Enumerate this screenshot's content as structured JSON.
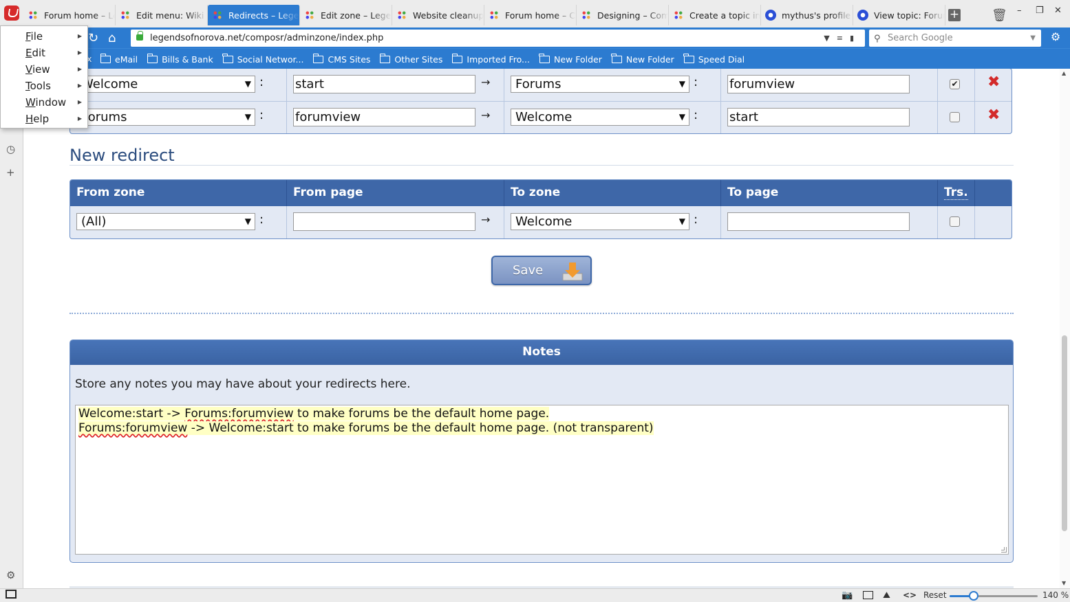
{
  "browser": {
    "tabs": [
      {
        "title": "Forum home – Leg",
        "icon": "composr-icon",
        "active": false
      },
      {
        "title": "Edit menu: Wiki – I",
        "icon": "composr-icon",
        "active": false
      },
      {
        "title": "Redirects – Legen",
        "icon": "composr-icon",
        "active": true
      },
      {
        "title": "Edit zone – Legenc",
        "icon": "composr-icon",
        "active": false
      },
      {
        "title": "Website cleanup t",
        "icon": "composr-icon",
        "active": false
      },
      {
        "title": "Forum home – Cor",
        "icon": "composr-icon",
        "active": false
      },
      {
        "title": "Designing – Comp",
        "icon": "composr-icon",
        "active": false
      },
      {
        "title": "Create a topic in D",
        "icon": "composr-icon",
        "active": false
      },
      {
        "title": "mythus's profile –",
        "icon": "globe-icon",
        "active": false
      },
      {
        "title": "View topic: Forum",
        "icon": "globe-icon",
        "active": false
      }
    ],
    "url": "legendsofnorova.net/composr/adminzone/index.php",
    "search_placeholder": "Search Google",
    "bookmarks": [
      {
        "label": "eMail"
      },
      {
        "label": "Bills & Bank"
      },
      {
        "label": "Social Networ..."
      },
      {
        "label": "CMS Sites"
      },
      {
        "label": "Other Sites"
      },
      {
        "label": "Imported Fro..."
      },
      {
        "label": "New Folder"
      },
      {
        "label": "New Folder"
      },
      {
        "label": "Speed Dial"
      }
    ],
    "bookmark_partial": "x",
    "accent_color": "#2c7bd0"
  },
  "menu": {
    "items": [
      {
        "label": "File",
        "accel": "F"
      },
      {
        "label": "Edit",
        "accel": "E"
      },
      {
        "label": "View",
        "accel": "V"
      },
      {
        "label": "Tools",
        "accel": "T"
      },
      {
        "label": "Window",
        "accel": "W"
      },
      {
        "label": "Help",
        "accel": "H"
      }
    ]
  },
  "existing": {
    "rows": [
      {
        "from_zone": "Welcome",
        "from_page": "start",
        "to_zone": "Forums",
        "to_page": "forumview",
        "transparent": true
      },
      {
        "from_zone": "Forums",
        "from_page": "forumview",
        "to_zone": "Welcome",
        "to_page": "start",
        "transparent": false
      }
    ]
  },
  "new_redirect": {
    "title": "New redirect",
    "headers": {
      "from_zone": "From zone",
      "from_page": "From page",
      "to_zone": "To zone",
      "to_page": "To page",
      "trs": "Trs."
    },
    "from_zone": "(All)",
    "from_page": "",
    "to_zone": "Welcome",
    "to_page": "",
    "transparent": false
  },
  "save_label": "Save",
  "notes": {
    "title": "Notes",
    "description": "Store any notes you may have about your redirects here.",
    "line1": {
      "a": "Welcome:start -> ",
      "b": "Forums:forumview",
      "c": " to make forums be the default home page."
    },
    "line2": {
      "a": "Forums:forumview",
      "b": " -> Welcome:start to make forums be the default home page. (not transparent)"
    }
  },
  "statusbar": {
    "reset_label": "Reset",
    "zoom": "140 %",
    "zoom_fraction": 0.27
  }
}
